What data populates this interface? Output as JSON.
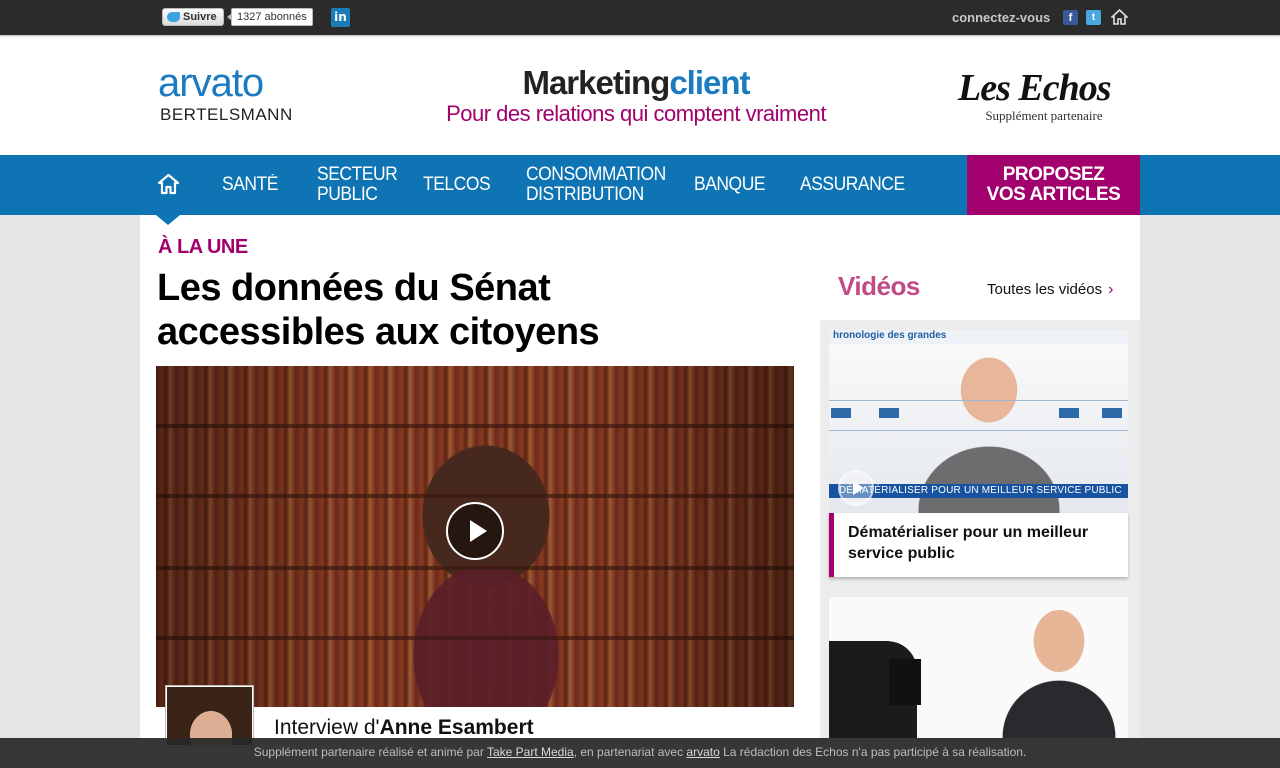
{
  "topbar": {
    "twitter_follow_label": "Suivre",
    "twitter_count": "1327 abonnés",
    "linkedin_label": "in",
    "facebook_label": "f",
    "twitter_icon_label": "t",
    "connect_label": "connectez-vous"
  },
  "header": {
    "arvato": "arvato",
    "bertelsmann": "BERTELSMANN",
    "title_part1": "Marketing",
    "title_part2": "client",
    "subtitle": "Pour des relations qui comptent vraiment",
    "lesechos": "Les Echos",
    "lesechos_sub": "Supplément partenaire"
  },
  "nav": {
    "items": [
      {
        "line1": "SANTÉ",
        "line2": ""
      },
      {
        "line1": "SECTEUR",
        "line2": "PUBLIC"
      },
      {
        "line1": "TELCOS",
        "line2": ""
      },
      {
        "line1": "CONSOMMATION",
        "line2": "DISTRIBUTION"
      },
      {
        "line1": "BANQUE",
        "line2": ""
      },
      {
        "line1": "ASSURANCE",
        "line2": ""
      }
    ],
    "propose_line1": "PROPOSEZ",
    "propose_line2": "VOS ARTICLES"
  },
  "main": {
    "section_label": "À LA UNE",
    "headline_line1": "Les données du Sénat",
    "headline_line2": "accessibles aux citoyens",
    "interview_prefix": "Interview d'",
    "interview_name": "Anne Esambert"
  },
  "sidebar": {
    "title": "Vidéos",
    "all_videos": "Toutes les vidéos",
    "card1_image_header": "hronologie des grandes",
    "card1_band": "DÉMATÉRIALISER POUR UN MEILLEUR SERVICE PUBLIC",
    "card1_caption_line1": "Dématérialiser pour un meilleur",
    "card1_caption_line2": "service public"
  },
  "footer": {
    "text1": "Supplément partenaire réalisé et animé par ",
    "link1": "Take Part Media",
    "text2": ", en partenariat avec ",
    "link2": "arvato",
    "text3": "  La rédaction des Echos n'a pas participé à sa réalisation."
  },
  "colors": {
    "nav_blue": "#0f74b4",
    "accent_magenta": "#a2006d",
    "topbar_dark": "#2b2b2b",
    "video_title_pink": "#c24a86"
  }
}
